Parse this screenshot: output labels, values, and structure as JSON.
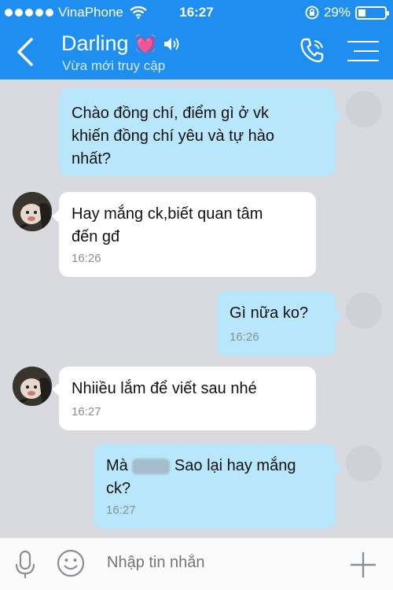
{
  "status_bar": {
    "signal_dots": 5,
    "carrier": "VinaPhone",
    "time": "16:27",
    "battery_percent": "29%",
    "battery_level": 0.29
  },
  "header": {
    "contact_name": "Darling",
    "name_emoji": "💓",
    "status": "Vừa mới truy cập",
    "accent_color": "#1e8ff0"
  },
  "messages": [
    {
      "direction": "outgoing",
      "lines": [
        "Chào đồng chí, điểm gì ở vk",
        "khiến đồng chí yêu và tự hào",
        "nhất?"
      ],
      "time": ""
    },
    {
      "direction": "incoming",
      "lines": [
        "Hay mắng ck,biết quan tâm",
        "đến gđ"
      ],
      "time": "16:26"
    },
    {
      "direction": "outgoing",
      "lines": [
        "Gì nữa ko?"
      ],
      "time": "16:26"
    },
    {
      "direction": "incoming",
      "lines": [
        "Nhiiều lắm để viết sau nhé"
      ],
      "time": "16:27"
    },
    {
      "direction": "outgoing",
      "prefix": "Mà",
      "suffix": "Sao lại hay mắng",
      "line2": "ck?",
      "time": "16:27"
    }
  ],
  "composer": {
    "placeholder": "Nhập tin nhắn"
  },
  "colors": {
    "outgoing_bubble": "#b8e6fb",
    "incoming_bubble": "#ffffff",
    "chat_background": "#d9dadf"
  }
}
